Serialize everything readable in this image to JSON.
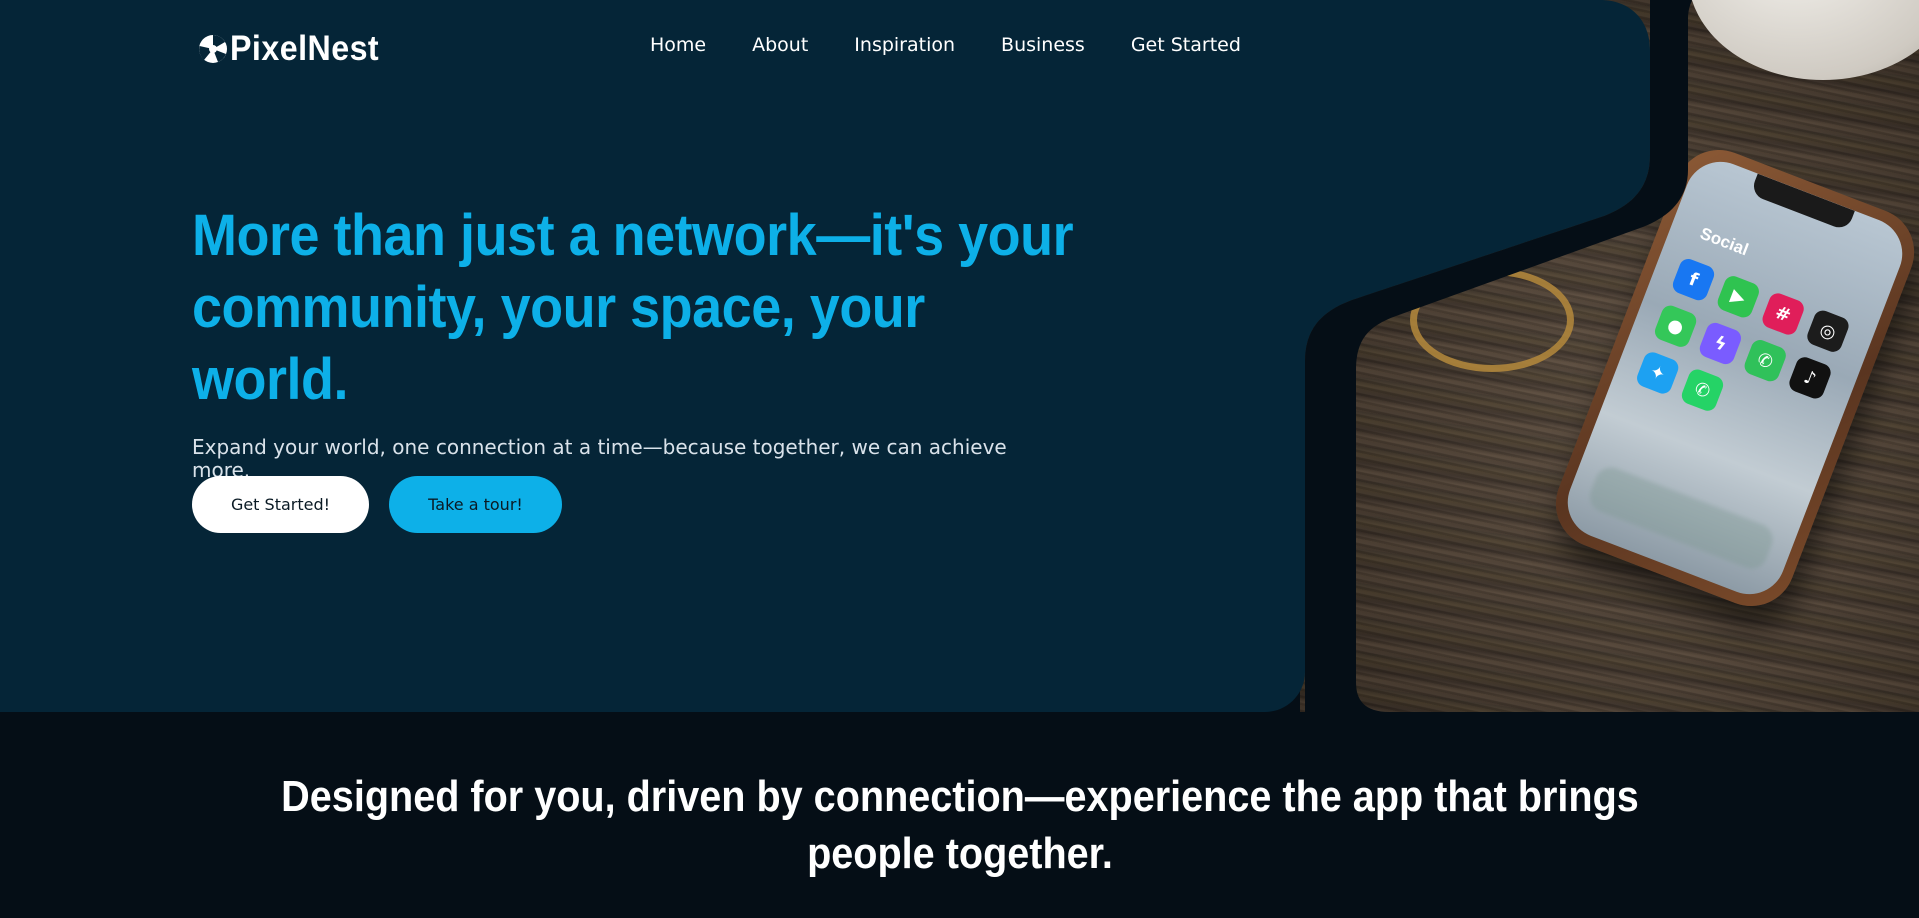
{
  "brand": {
    "name": "PixelNest",
    "accent_color": "#0db0e8",
    "panel_color": "#052537",
    "background_color": "#050e16",
    "logo_icon": "aperture-icon"
  },
  "nav": {
    "items": [
      {
        "label": "Home"
      },
      {
        "label": "About"
      },
      {
        "label": "Inspiration"
      },
      {
        "label": "Business"
      },
      {
        "label": "Get Started"
      }
    ]
  },
  "hero": {
    "title": "More than just a network—it's your community, your space, your world.",
    "subtitle": "Expand your world, one connection at a time—because together, we can achieve more.",
    "primary_button": "Get Started!",
    "secondary_button": "Take a tour!"
  },
  "phone": {
    "folder_label": "Social",
    "apps": [
      {
        "icon": "facebook-icon",
        "glyph": "f",
        "color": "#1877f2"
      },
      {
        "icon": "facetime-icon",
        "glyph": "▶",
        "color": "#2fc350"
      },
      {
        "icon": "slack-icon",
        "glyph": "#",
        "color": "#e01e5a"
      },
      {
        "icon": "instagram-icon",
        "glyph": "◎",
        "color": "#1c1c1c"
      },
      {
        "icon": "messages-icon",
        "glyph": "●",
        "color": "#34c759"
      },
      {
        "icon": "messenger-icon",
        "glyph": "ϟ",
        "color": "#7a5cff"
      },
      {
        "icon": "phone-icon",
        "glyph": "✆",
        "color": "#30c15a"
      },
      {
        "icon": "tiktok-icon",
        "glyph": "♪",
        "color": "#111111"
      },
      {
        "icon": "twitter-icon",
        "glyph": "✦",
        "color": "#1da1f2"
      },
      {
        "icon": "whatsapp-icon",
        "glyph": "✆",
        "color": "#25d366"
      }
    ]
  },
  "tagline": {
    "text": "Designed for you, driven by connection—experience the app that brings people together."
  }
}
